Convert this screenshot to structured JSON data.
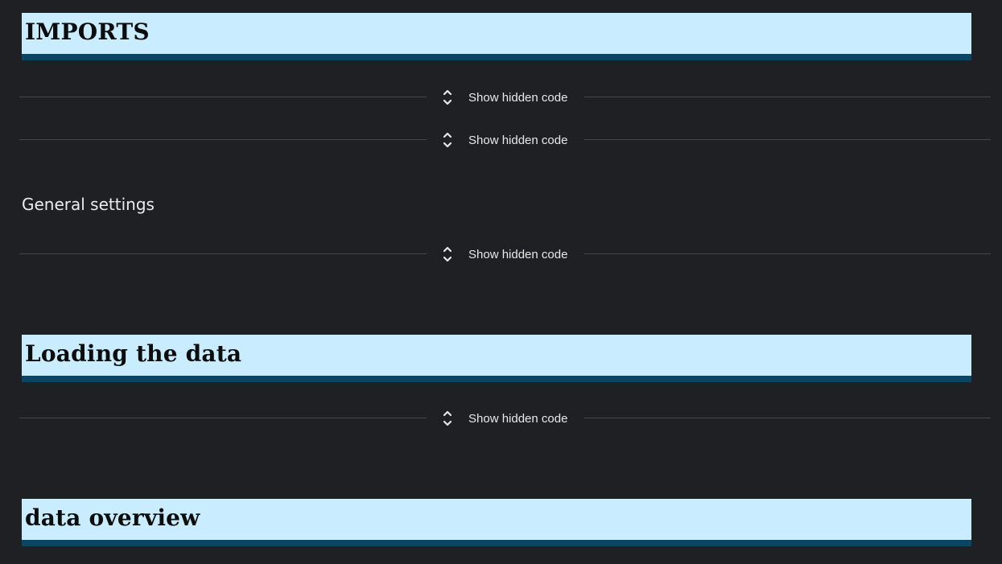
{
  "cells": {
    "imports_header": "IMPORTS",
    "hidden_code_1": "Show hidden code",
    "hidden_code_2": "Show hidden code",
    "general_settings": "General settings",
    "hidden_code_3": "Show hidden code",
    "loading_header": "Loading the data",
    "hidden_code_4": "Show hidden code",
    "overview_header": "data overview"
  },
  "icons": {
    "expand": "chevron-up-down-icon"
  },
  "colors": {
    "background": "#1f2023",
    "header_fill": "#c9ecff",
    "header_underline": "#0b4566",
    "divider": "#45474c",
    "text": "#e8e8e8"
  }
}
